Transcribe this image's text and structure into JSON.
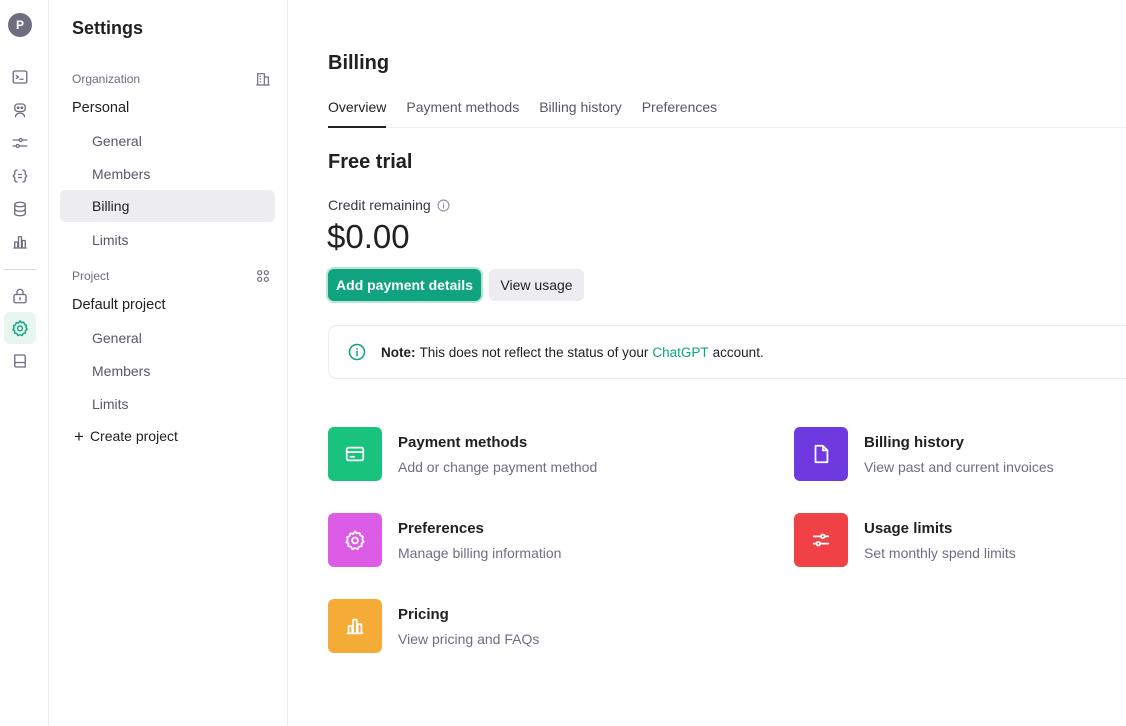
{
  "user": {
    "avatar_initial": "P"
  },
  "sidebar": {
    "title": "Settings",
    "organization": {
      "label": "Organization",
      "name": "Personal",
      "items": [
        {
          "label": "General"
        },
        {
          "label": "Members"
        },
        {
          "label": "Billing",
          "active": true
        },
        {
          "label": "Limits"
        }
      ]
    },
    "project": {
      "label": "Project",
      "name": "Default project",
      "items": [
        {
          "label": "General"
        },
        {
          "label": "Members"
        },
        {
          "label": "Limits"
        }
      ]
    },
    "create_project": "Create project"
  },
  "main": {
    "title": "Billing",
    "tabs": [
      {
        "label": "Overview",
        "active": true
      },
      {
        "label": "Payment methods"
      },
      {
        "label": "Billing history"
      },
      {
        "label": "Preferences"
      }
    ],
    "section_title": "Free trial",
    "credit_label": "Credit remaining",
    "credit_value": "$0.00",
    "buttons": {
      "add_payment": "Add payment details",
      "view_usage": "View usage"
    },
    "note": {
      "prefix": "Note:",
      "text_before": "This does not reflect the status of your",
      "link": "ChatGPT",
      "text_after": "account."
    },
    "cards": [
      {
        "title": "Payment methods",
        "desc": "Add or change payment method",
        "icon": "credit-card-icon",
        "color": "#19c37d"
      },
      {
        "title": "Billing history",
        "desc": "View past and current invoices",
        "icon": "document-icon",
        "color": "#6e3ae0"
      },
      {
        "title": "Preferences",
        "desc": "Manage billing information",
        "icon": "gear-icon",
        "color": "#dd5ce5"
      },
      {
        "title": "Usage limits",
        "desc": "Set monthly spend limits",
        "icon": "sliders-icon",
        "color": "#ef4146"
      },
      {
        "title": "Pricing",
        "desc": "View pricing and FAQs",
        "icon": "bar-chart-icon",
        "color": "#f4ac36"
      }
    ]
  },
  "colors": {
    "accent": "#10a37f",
    "active_nav_bg": "#ececf1"
  }
}
